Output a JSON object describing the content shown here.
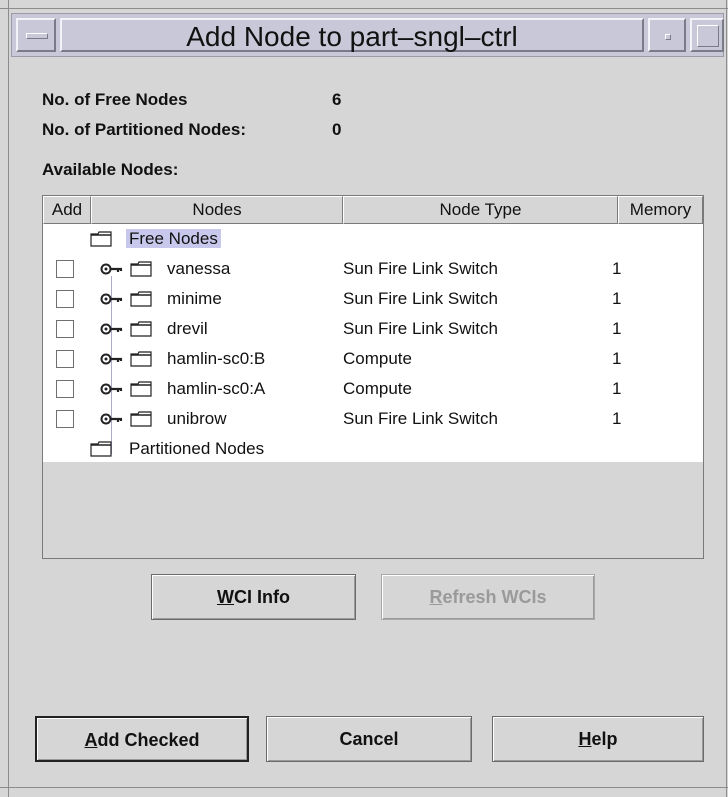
{
  "dialog": {
    "title": "Add Node to part–sngl–ctrl"
  },
  "summary": {
    "free_label": "No. of Free Nodes",
    "free_value": "6",
    "partitioned_label": "No. of Partitioned Nodes:",
    "partitioned_value": "0"
  },
  "available_label": "Available Nodes:",
  "table": {
    "columns": [
      "Add",
      "Nodes",
      "Node Type",
      "Memory"
    ],
    "groups": {
      "free": "Free Nodes",
      "partitioned": "Partitioned Nodes"
    },
    "rows": [
      {
        "name": "vanessa",
        "type": "Sun Fire Link Switch",
        "memory": "1",
        "checked": false
      },
      {
        "name": "minime",
        "type": "Sun Fire Link Switch",
        "memory": "1",
        "checked": false
      },
      {
        "name": "drevil",
        "type": "Sun Fire Link Switch",
        "memory": "1",
        "checked": false
      },
      {
        "name": "hamlin-sc0:B",
        "type": "Compute",
        "memory": "1",
        "checked": false
      },
      {
        "name": "hamlin-sc0:A",
        "type": "Compute",
        "memory": "1",
        "checked": false
      },
      {
        "name": "unibrow",
        "type": "Sun Fire Link Switch",
        "memory": "1",
        "checked": false
      }
    ]
  },
  "buttons": {
    "wci_info": {
      "mnemonic": "W",
      "rest": "CI Info"
    },
    "refresh_wcis": {
      "mnemonic": "R",
      "rest": "efresh WCIs"
    },
    "add_checked": {
      "mnemonic": "A",
      "rest": "dd Checked"
    },
    "cancel": "Cancel",
    "help": {
      "mnemonic": "H",
      "rest": "elp"
    }
  },
  "icons": {
    "window_menu": "window-menu-icon",
    "minimize": "minimize-icon",
    "maximize": "maximize-icon",
    "folder": "folder-icon",
    "key": "key-icon"
  }
}
